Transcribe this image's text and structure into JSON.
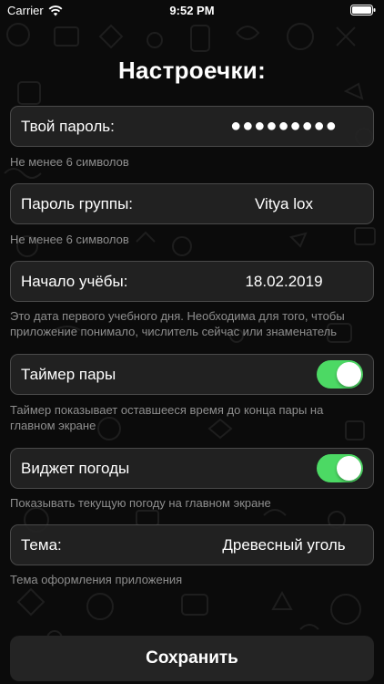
{
  "status_bar": {
    "carrier": "Carrier",
    "time": "9:52 PM",
    "wifi_icon": "wifi-icon",
    "battery_icon": "battery-icon"
  },
  "page": {
    "title": "Настроечки:"
  },
  "fields": {
    "password": {
      "label": "Твой пароль:",
      "value": "●●●●●●●●●",
      "hint": "Не менее 6 символов"
    },
    "group_password": {
      "label": "Пароль группы:",
      "value": "Vitya lox",
      "hint": "Не менее 6 символов"
    },
    "study_start": {
      "label": "Начало учёбы:",
      "value": "18.02.2019",
      "hint_line1": "Это дата первого учебного дня. Необходима для того, чтобы",
      "hint_line2": "приложение понимало, числитель сейчас или знаменатель"
    },
    "pair_timer": {
      "label": "Таймер пары",
      "enabled": true,
      "hint_line1": "Таймер показывает оставшееся время до конца пары на",
      "hint_line2": "главном экране"
    },
    "weather_widget": {
      "label": "Виджет погоды",
      "enabled": true,
      "hint": "Показывать текущую погоду на главном экране"
    },
    "theme": {
      "label": "Тема:",
      "value": "Древесный уголь",
      "hint": "Тема оформления приложения"
    }
  },
  "actions": {
    "save_label": "Сохранить"
  },
  "colors": {
    "background": "#0b0b0b",
    "row_background": "#242424",
    "row_border": "#4a4a4a",
    "toggle_on": "#4cd964",
    "hint_text": "#8e8e8e"
  }
}
